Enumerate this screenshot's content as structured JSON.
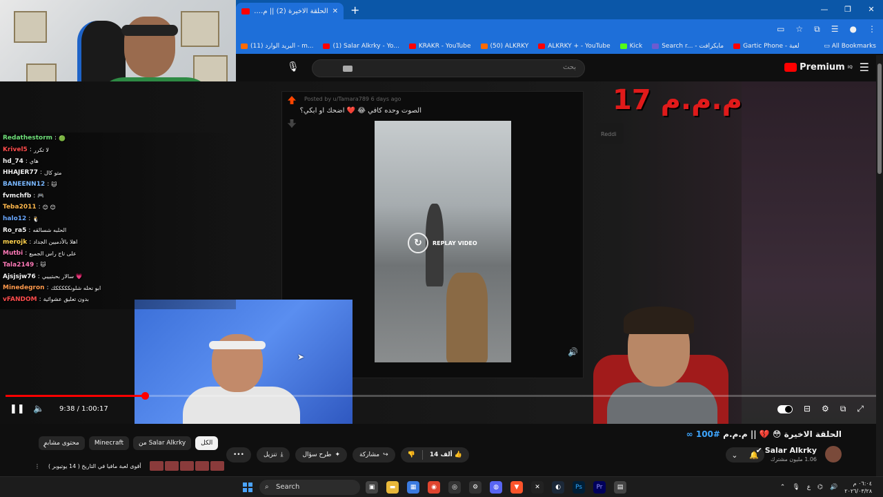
{
  "browser": {
    "tab_title": "الحلقة الاخيرة (2) || م.م...",
    "new_tab": "+",
    "win_min": "—",
    "win_max": "❐",
    "win_close": "✕",
    "bookmarks": [
      {
        "label": "(11) البريد الوارد - m...",
        "color": "#ff6a00"
      },
      {
        "label": "(1) Salar Alkrky - Yo...",
        "color": "#ff0000"
      },
      {
        "label": "KRAKR - YouTube",
        "color": "#ff0000"
      },
      {
        "label": "(50) ALKRKY",
        "color": "#ff6a00"
      },
      {
        "label": "ALKRKY + - YouTube",
        "color": "#ff0000"
      },
      {
        "label": "Kick",
        "color": "#53fc18"
      },
      {
        "label": "Search r... - مايكرافت",
        "color": "#6d5bd0"
      },
      {
        "label": "Gartic Phone - لعبة",
        "color": "#ff0000"
      }
    ],
    "all_bookmarks": "All Bookmarks"
  },
  "youtube_header": {
    "search_placeholder": "بحث",
    "premium": "Premium",
    "premium_sup": "IQ"
  },
  "reddit_post": {
    "posted_by": "Posted by u/Tamara789 6 days ago",
    "title": "الصوت وحده كافي 😂 ❤️ اضحك او ابكي؟",
    "replay": "REPLAY VIDEO"
  },
  "overlay_title": "م.م.م 17",
  "reddit_tag": "Reddi",
  "chat": [
    {
      "user": "Redathestorm",
      "msg": "🟢",
      "color": "#6fe07a"
    },
    {
      "user": "Krivel5",
      "msg": "لا تكرر",
      "color": "#ff4d4d"
    },
    {
      "user": "hd_74",
      "msg": "هاي",
      "color": "#f1f1f1"
    },
    {
      "user": "HHAJER77",
      "msg": "متو كال",
      "color": "#f1f1f1"
    },
    {
      "user": "BANEENN12",
      "msg": "🐱",
      "color": "#7ab8ff"
    },
    {
      "user": "fvmchfb",
      "msg": "🎮",
      "color": "#f1f1f1"
    },
    {
      "user": "Teba2011",
      "msg": "😊 😊",
      "color": "#ffb84d"
    },
    {
      "user": "halo12",
      "msg": "🐧",
      "color": "#6aa8ff"
    },
    {
      "user": "Ro_ra5",
      "msg": "الحلبه شسالقه",
      "color": "#f1f1f1"
    },
    {
      "user": "merojk",
      "msg": "اهلا بالأدميين الجداد",
      "color": "#ffd24d"
    },
    {
      "user": "Mutbi",
      "msg": "على تاج راس الجميع",
      "color": "#ff7ab8"
    },
    {
      "user": "Tala2149",
      "msg": "🐱",
      "color": "#ff7ab8"
    },
    {
      "user": "Ajsjsjw76",
      "msg": "سالار بحبتيييي 💗",
      "color": "#f1f1f1"
    },
    {
      "user": "Minedegron",
      "msg": "ابو نحله شلونكككككك",
      "color": "#ff9a4d"
    },
    {
      "user": "vFANDOM",
      "msg": "بدون تعليق عشوائية",
      "color": "#ff4d4d"
    }
  ],
  "player": {
    "time": "9:38 / 1:00:17",
    "progress": 0.16
  },
  "video": {
    "title_prefix": "الحلقة الاخيرة 😳 💔 || م.م.م",
    "title_tag": "#100 ∞",
    "channel": "Salar Alkrky",
    "subscribers": "1.06 مليون مشترك",
    "likes": "14 ألف",
    "share": "مشاركة",
    "ask": "طرح سؤال",
    "download": "تنزيل",
    "more": "•••"
  },
  "chips": [
    {
      "label": "محتوى مشابه",
      "active": false
    },
    {
      "label": "Minecraft",
      "active": false
    },
    {
      "label": "من Salar Alkrky",
      "active": false
    },
    {
      "label": "الكل",
      "active": true
    }
  ],
  "recommendation": "أقوى لعبة مافيا في التاريخ ( 14 يوتيوبر )",
  "taskbar": {
    "search": "Search",
    "time": "٠٦:٠٤ م",
    "date": "٢٠٢٦/٠٣/٢٨",
    "lang": "ع"
  }
}
